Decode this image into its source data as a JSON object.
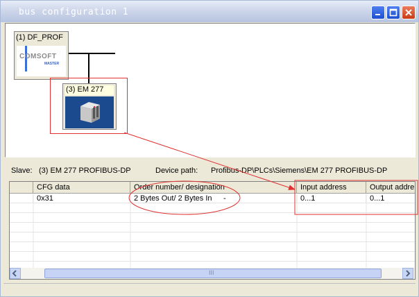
{
  "window": {
    "title": "bus configuration 1"
  },
  "canvas": {
    "master_label": "(1) DF_PROF",
    "master_logo_text": "COMSOFT",
    "master_logo_sub": "MASTER",
    "slave_label": "(3) EM 277"
  },
  "info": {
    "slave_caption": "Slave:",
    "slave_value": "(3) EM 277 PROFIBUS-DP",
    "path_caption": "Device path:",
    "path_value": "Profibus-DP\\PLCs\\Siemens\\EM 277 PROFIBUS-DP"
  },
  "table": {
    "headers": [
      "",
      "CFG data",
      "Order number/ designation",
      "Input address",
      "Output addre"
    ],
    "rows": [
      [
        "",
        "0x31",
        "2 Bytes Out/ 2 Bytes In",
        "0...1",
        "0...1"
      ]
    ],
    "row_extra": "-",
    "scroll_grip": "III"
  },
  "colors": {
    "annotation": "#e03030",
    "title_blue": "#1b4fd0"
  }
}
